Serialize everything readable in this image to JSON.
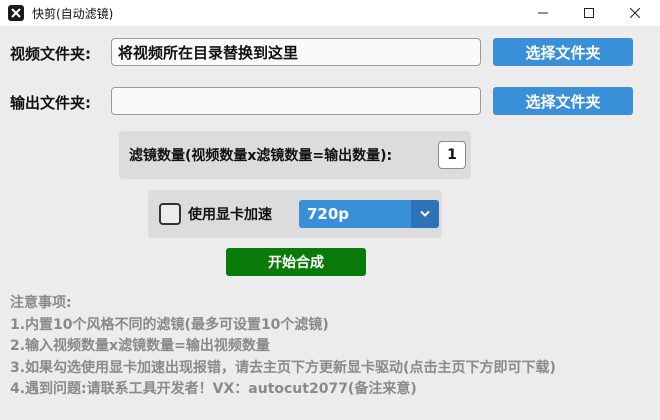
{
  "window": {
    "title": "快剪(自动滤镜)",
    "icon": "app-logo-icon",
    "controls": [
      "minimize-icon",
      "maximize-icon",
      "close-icon"
    ]
  },
  "video_folder": {
    "label": "视频文件夹:",
    "value": "将视频所在目录替换到这里",
    "button": "选择文件夹"
  },
  "output_folder": {
    "label": "输出文件夹:",
    "value": "",
    "button": "选择文件夹"
  },
  "filter_count": {
    "label": "滤镜数量(视频数量x滤镜数量=输出数量):",
    "value": "1"
  },
  "gpu": {
    "label": "使用显卡加速",
    "checked": false,
    "resolution": "720p"
  },
  "start_button": "开始合成",
  "notes": {
    "title": "注意事项:",
    "lines": [
      "1.内置10个风格不同的滤镜(最多可设置10个滤镜)",
      "2.输入视频数量x滤镜数量=输出视频数量",
      "3.如果勾选使用显卡加速出现报错，请去主页下方更新显卡驱动(点击主页下方即可下载)",
      "4.遇到问题:请联系工具开发者！VX：autocut2077(备注来意)"
    ]
  },
  "colors": {
    "accent_blue": "#3a8fd9",
    "start_green": "#0a7a0a",
    "note_gray": "#8a8a8a"
  }
}
